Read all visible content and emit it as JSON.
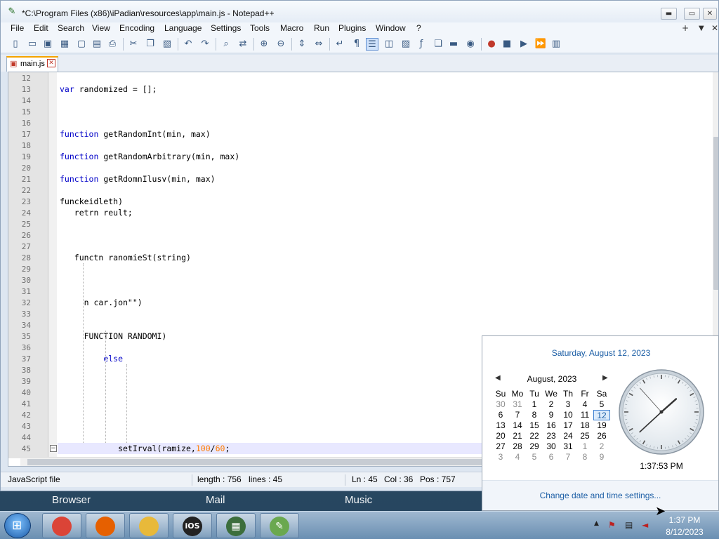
{
  "window": {
    "title": "*C:\\Program Files (x86)\\iPadian\\resources\\app\\main.js - Notepad++",
    "controls": {
      "minimize": "▬",
      "maximize": "▭",
      "close": "✕"
    }
  },
  "menu": [
    "File",
    "Edit",
    "Search",
    "View",
    "Encoding",
    "Language",
    "Settings",
    "Tools",
    "Macro",
    "Run",
    "Plugins",
    "Window",
    "?"
  ],
  "menu_right": {
    "plus": "+",
    "down": "▼",
    "close": "✕"
  },
  "toolbar_icons": [
    "new-file-icon",
    "open-file-icon",
    "save-icon",
    "save-all-icon",
    "close-icon",
    "close-all-icon",
    "print-icon",
    "cut-icon",
    "copy-icon",
    "paste-icon",
    "undo-icon",
    "redo-icon",
    "find-icon",
    "replace-icon",
    "zoom-in-icon",
    "zoom-out-icon",
    "sync-vertical-icon",
    "sync-horizontal-icon",
    "word-wrap-icon",
    "show-all-chars-icon",
    "indent-guide-icon",
    "language-icon",
    "map-icon",
    "function-list-icon",
    "doc-switcher-icon",
    "folder-icon",
    "monitor-icon",
    "record-macro-icon",
    "stop-record-icon",
    "play-macro-icon",
    "run-macro-multiple-icon",
    "save-macro-icon"
  ],
  "tab": {
    "label": "main.js"
  },
  "editor": {
    "lines": [
      {
        "n": "12",
        "text": ""
      },
      {
        "n": "13",
        "text": "var randomized = [];"
      },
      {
        "n": "14",
        "text": ""
      },
      {
        "n": "15",
        "text": ""
      },
      {
        "n": "16",
        "text": ""
      },
      {
        "n": "17",
        "text": "function getRandomInt(min, max)"
      },
      {
        "n": "18",
        "text": ""
      },
      {
        "n": "19",
        "text": "function getRandomArbitrary(min, max)"
      },
      {
        "n": "20",
        "text": ""
      },
      {
        "n": "21",
        "text": "function getRdomnIlusv(min, max)"
      },
      {
        "n": "22",
        "text": ""
      },
      {
        "n": "23",
        "text": "funckeidleth)"
      },
      {
        "n": "24",
        "text": "   retrn reult;"
      },
      {
        "n": "25",
        "text": ""
      },
      {
        "n": "26",
        "text": ""
      },
      {
        "n": "27",
        "text": ""
      },
      {
        "n": "28",
        "text": "   functn ranomieSt(string)"
      },
      {
        "n": "29",
        "text": ""
      },
      {
        "n": "30",
        "text": ""
      },
      {
        "n": "31",
        "text": ""
      },
      {
        "n": "32",
        "text": "     n car.jon\"\")"
      },
      {
        "n": "33",
        "text": ""
      },
      {
        "n": "34",
        "text": ""
      },
      {
        "n": "35",
        "text": "     FUNCTION RANDOMI)"
      },
      {
        "n": "36",
        "text": ""
      },
      {
        "n": "37",
        "text": "         else"
      },
      {
        "n": "38",
        "text": ""
      },
      {
        "n": "39",
        "text": ""
      },
      {
        "n": "40",
        "text": ""
      },
      {
        "n": "41",
        "text": ""
      },
      {
        "n": "42",
        "text": ""
      },
      {
        "n": "43",
        "text": ""
      },
      {
        "n": "44",
        "text": ""
      },
      {
        "n": "45",
        "text": "            setIrval(ramize,100/60;"
      }
    ]
  },
  "status": {
    "language": "JavaScript file",
    "length": "length : 756",
    "lines": "lines : 45",
    "ln": "Ln : 45",
    "col": "Col : 36",
    "pos": "Pos : 757"
  },
  "desktop_labels": [
    "Browser",
    "Mail",
    "Music"
  ],
  "calendar": {
    "full_date": "Saturday, August 12, 2023",
    "month_label": "August, 2023",
    "prev": "◀",
    "next": "▶",
    "weekdays": [
      "Su",
      "Mo",
      "Tu",
      "We",
      "Th",
      "Fr",
      "Sa"
    ],
    "weeks": [
      [
        "30",
        "31",
        "1",
        "2",
        "3",
        "4",
        "5"
      ],
      [
        "6",
        "7",
        "8",
        "9",
        "10",
        "11",
        "12"
      ],
      [
        "13",
        "14",
        "15",
        "16",
        "17",
        "18",
        "19"
      ],
      [
        "20",
        "21",
        "22",
        "23",
        "24",
        "25",
        "26"
      ],
      [
        "27",
        "28",
        "29",
        "30",
        "31",
        "1",
        "2"
      ],
      [
        "3",
        "4",
        "5",
        "6",
        "7",
        "8",
        "9"
      ]
    ],
    "today": "12",
    "clock_time": "1:37:53 PM",
    "clock": {
      "hours": 1,
      "minutes": 37,
      "seconds": 53
    },
    "footer_link": "Change date and time settings..."
  },
  "taskbar": {
    "apps": [
      {
        "name": "chrome",
        "glyph": "",
        "color": "#db4437"
      },
      {
        "name": "firefox",
        "glyph": "",
        "color": "#e66000"
      },
      {
        "name": "explorer",
        "glyph": "",
        "color": "#e8b93a"
      },
      {
        "name": "ios",
        "glyph": "iOS",
        "color": "#222222"
      },
      {
        "name": "monitor",
        "glyph": "▦",
        "color": "#3c6e3c"
      },
      {
        "name": "notepadpp",
        "glyph": "✎",
        "color": "#6aa84f"
      }
    ],
    "tray": {
      "time": "1:37 PM",
      "date": "8/12/2023"
    }
  },
  "colors": {
    "keyword": "#0000c8",
    "number": "#ff7a00",
    "link": "#1d5fa6"
  }
}
